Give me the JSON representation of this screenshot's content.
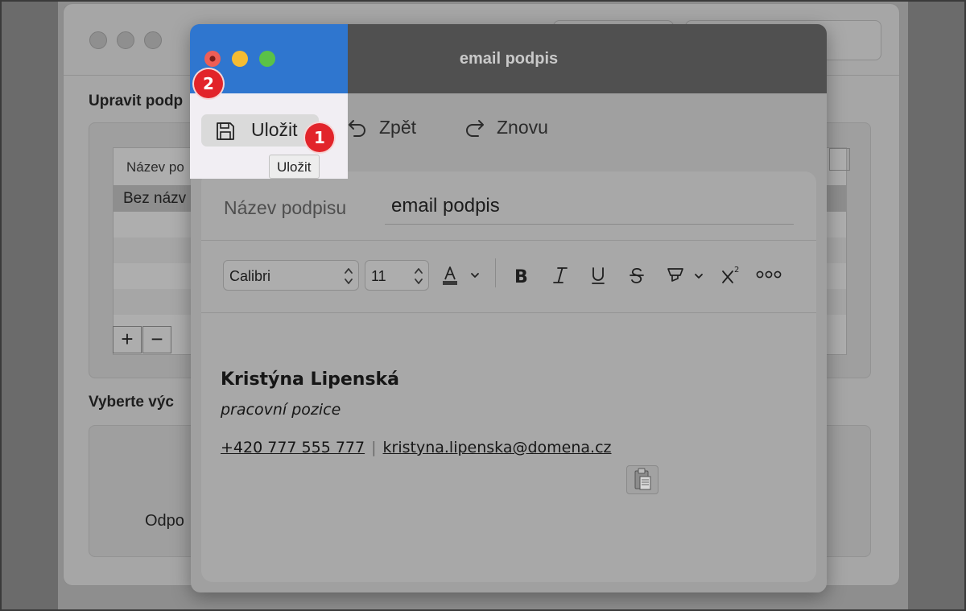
{
  "background_window": {
    "heading_edit": "Upravit podp",
    "heading_select": "Vyberte výc",
    "table": {
      "column_header": "Název po",
      "rows": [
        "Bez názv"
      ]
    },
    "add_button": "+",
    "remove_button": "−",
    "bottom_text": "Odpo"
  },
  "dialog": {
    "title": "email podpis",
    "toolbar": {
      "save_label": "Uložit",
      "undo_label": "Zpět",
      "redo_label": "Znovu"
    },
    "tooltip": "Uložit",
    "signature_name_label": "Název podpisu",
    "signature_name_value": "email podpis",
    "format_bar": {
      "font": "Calibri",
      "size": "11",
      "superscript_icon": "superscript-icon",
      "more_icon": "more-icon"
    },
    "signature": {
      "name": "Kristýna Lipenská",
      "role": "pracovní pozice",
      "phone": "+420 777 555 777",
      "separator": "|",
      "email": "kristyna.lipenska@domena.cz"
    }
  },
  "annotations": {
    "badge_1": "1",
    "badge_2": "2"
  },
  "colors": {
    "highlight_titlebar": "#2f76cf",
    "badge": "#e2242a",
    "close_light": "#ee5e56",
    "minimize_light": "#f5bc33",
    "zoom_light": "#5ac247"
  }
}
